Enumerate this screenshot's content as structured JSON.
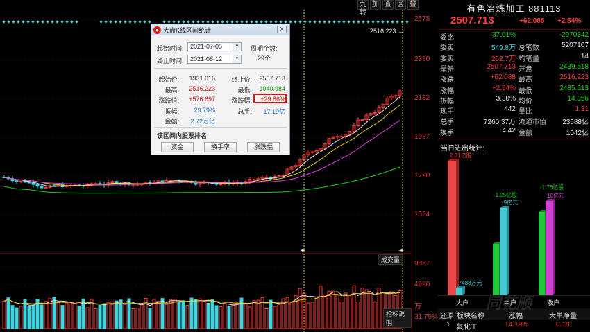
{
  "toolbar": {
    "buttons": [
      "九转",
      "加",
      "查",
      "区",
      "叠"
    ]
  },
  "price_axis": [
    "2575",
    "2380",
    "2182",
    "1987",
    "1790",
    "1594",
    "9867",
    "4990",
    "万",
    "31.79%"
  ],
  "chart_labels": {
    "high_marker": "2516.223",
    "volume_btn": "成交量",
    "indicator_btn": "指标说明"
  },
  "dialog": {
    "title": "大盘K线区间统计",
    "close": "X",
    "start_label": "起始时间:",
    "start_value": "2021-07-05",
    "end_label": "终止时间:",
    "end_value": "2021-08-12",
    "period_label": "周期个数:",
    "period_value": "29个",
    "stats": {
      "open_label": "起始价:",
      "open_value": "1931.016",
      "close_label": "终止价:",
      "close_value": "2507.713",
      "high_label": "最高:",
      "high_value": "2516.223",
      "low_label": "最低:",
      "low_value": "1940.984",
      "chg_label": "涨跌值:",
      "chg_value": "+576.697",
      "pct_label": "涨跌幅:",
      "pct_value": "+29.86%",
      "amp_label": "振幅:",
      "amp_value": "29.79%",
      "hand_label": "总手:",
      "hand_value": "17.19亿",
      "amount_label": "金额:",
      "amount_value": "2.72万亿"
    },
    "rank_title": "该区间内股票排名",
    "buttons": [
      "资金",
      "换手率",
      "涨跌幅"
    ]
  },
  "right": {
    "title": "有色冶炼加工  881113",
    "price": "2507.713",
    "change": "+62.088",
    "change_pct": "+2.54%",
    "quote": [
      {
        "l1": "委比",
        "v1": "-37.01%",
        "c1": "green",
        "l2": "",
        "v2": "-2970342",
        "c2": "green"
      },
      {
        "l1": "委卖",
        "v1": "549.8万",
        "c1": "cyan",
        "l2": "总笔数",
        "v2": "5207107",
        "c2": "white"
      },
      {
        "l1": "委买",
        "v1": "252.7万",
        "c1": "red",
        "l2": "均笔量",
        "v2": "14",
        "c2": "white"
      },
      {
        "l1": "最新",
        "v1": "2507.713",
        "c1": "red",
        "l2": "开盘",
        "v2": "2439.518",
        "c2": "green"
      },
      {
        "l1": "涨跌",
        "v1": "+62.088",
        "c1": "red",
        "l2": "最高",
        "v2": "2516.223",
        "c2": "red"
      },
      {
        "l1": "涨幅",
        "v1": "+2.54%",
        "c1": "red",
        "l2": "最低",
        "v2": "2435.513",
        "c2": "green"
      },
      {
        "l1": "振幅",
        "v1": "3.30%",
        "c1": "white",
        "l2": "均价",
        "v2": "14.356",
        "c2": "green"
      },
      {
        "l1": "现手",
        "v1": "442",
        "c1": "white",
        "l2": "量比",
        "v2": "1.31",
        "c2": "red"
      },
      {
        "l1": "总手",
        "v1": "7260.37万",
        "c1": "white",
        "l2": "流通市值",
        "v2": "23588亿",
        "c2": "white"
      },
      {
        "l1": "换手",
        "v1": "4.42",
        "c1": "white",
        "l2": "金额",
        "v2": "1042亿",
        "c2": "white"
      }
    ],
    "flow_title": "当日进出统计:",
    "flow_labels": {
      "big_in": "2.81亿股",
      "big_out": "-7488万元",
      "mid_in": "-1.05亿股",
      "mid_out": "-9亿元",
      "small_in": "-1.76亿股",
      "small_out": "10亿元"
    },
    "flow_cats": [
      "大户",
      "中户",
      "散户"
    ],
    "rank_header": [
      "还原",
      "板块名称",
      "涨幅",
      "大单净量"
    ],
    "rank_row": [
      "1",
      "氟化工",
      "+4.19%",
      "0.18"
    ],
    "watermark": "同花顺"
  },
  "chart_data": {
    "type": "candlestick",
    "ylim": [
      1500,
      2600
    ],
    "high": 2516.223
  },
  "colors": {
    "up": "#ff3b3b",
    "down": "#3fd5e0",
    "ma5": "#e6e6e6",
    "ma10": "#e6d21a",
    "ma20": "#e040e0",
    "ma60": "#19d419"
  }
}
